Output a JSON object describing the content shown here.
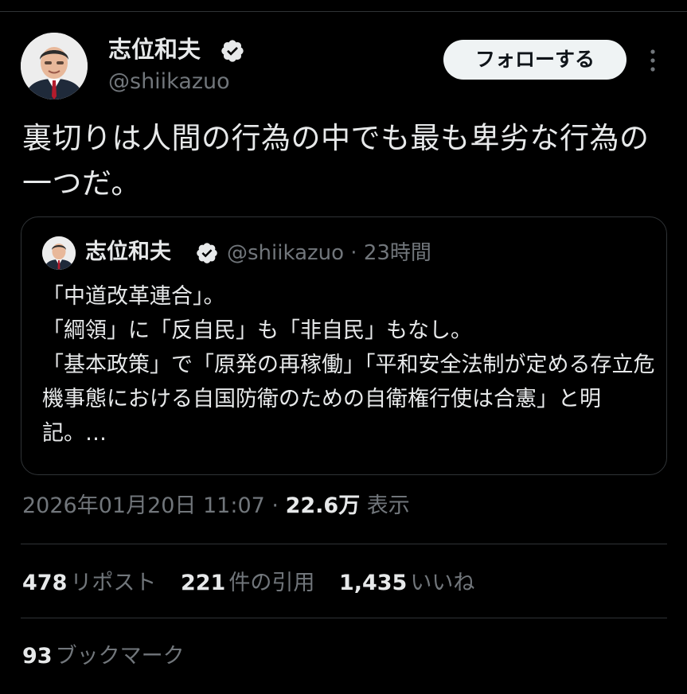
{
  "author": {
    "display_name": "志位和夫",
    "handle": "@shiikazuo",
    "verified_icon": "verified-badge-icon"
  },
  "actions": {
    "follow_label": "フォローする",
    "more_icon": "more-vertical-icon"
  },
  "tweet": {
    "text": "裏切りは人間の行為の中でも最も卑劣な行為の一つだ。"
  },
  "quote": {
    "display_name": "志位和夫",
    "meta": "@shiikazuo · 23時間",
    "text": "「中道改革連合」。\n「綱領」に「反自民」も「非自民」もなし。\n「基本政策」で「原発の再稼働」「平和安全法制が定める存立危機事態における自国防衛のための自衛権行使は合憲」と明記。…"
  },
  "timestamp": {
    "datetime": "2026年01月20日 11:07",
    "separator": " · ",
    "views_count": "22.6万",
    "views_label": "表示"
  },
  "stats": {
    "reposts_count": "478",
    "reposts_label": "リポスト",
    "quotes_count": "221",
    "quotes_label": "件の引用",
    "likes_count": "1,435",
    "likes_label": "いいね",
    "bookmarks_count": "93",
    "bookmarks_label": "ブックマーク"
  },
  "colors": {
    "background": "#000000",
    "text_primary": "#e7e9ea",
    "text_secondary": "#71767b",
    "border": "#2f3336",
    "follow_button_bg": "#eff3f4"
  }
}
